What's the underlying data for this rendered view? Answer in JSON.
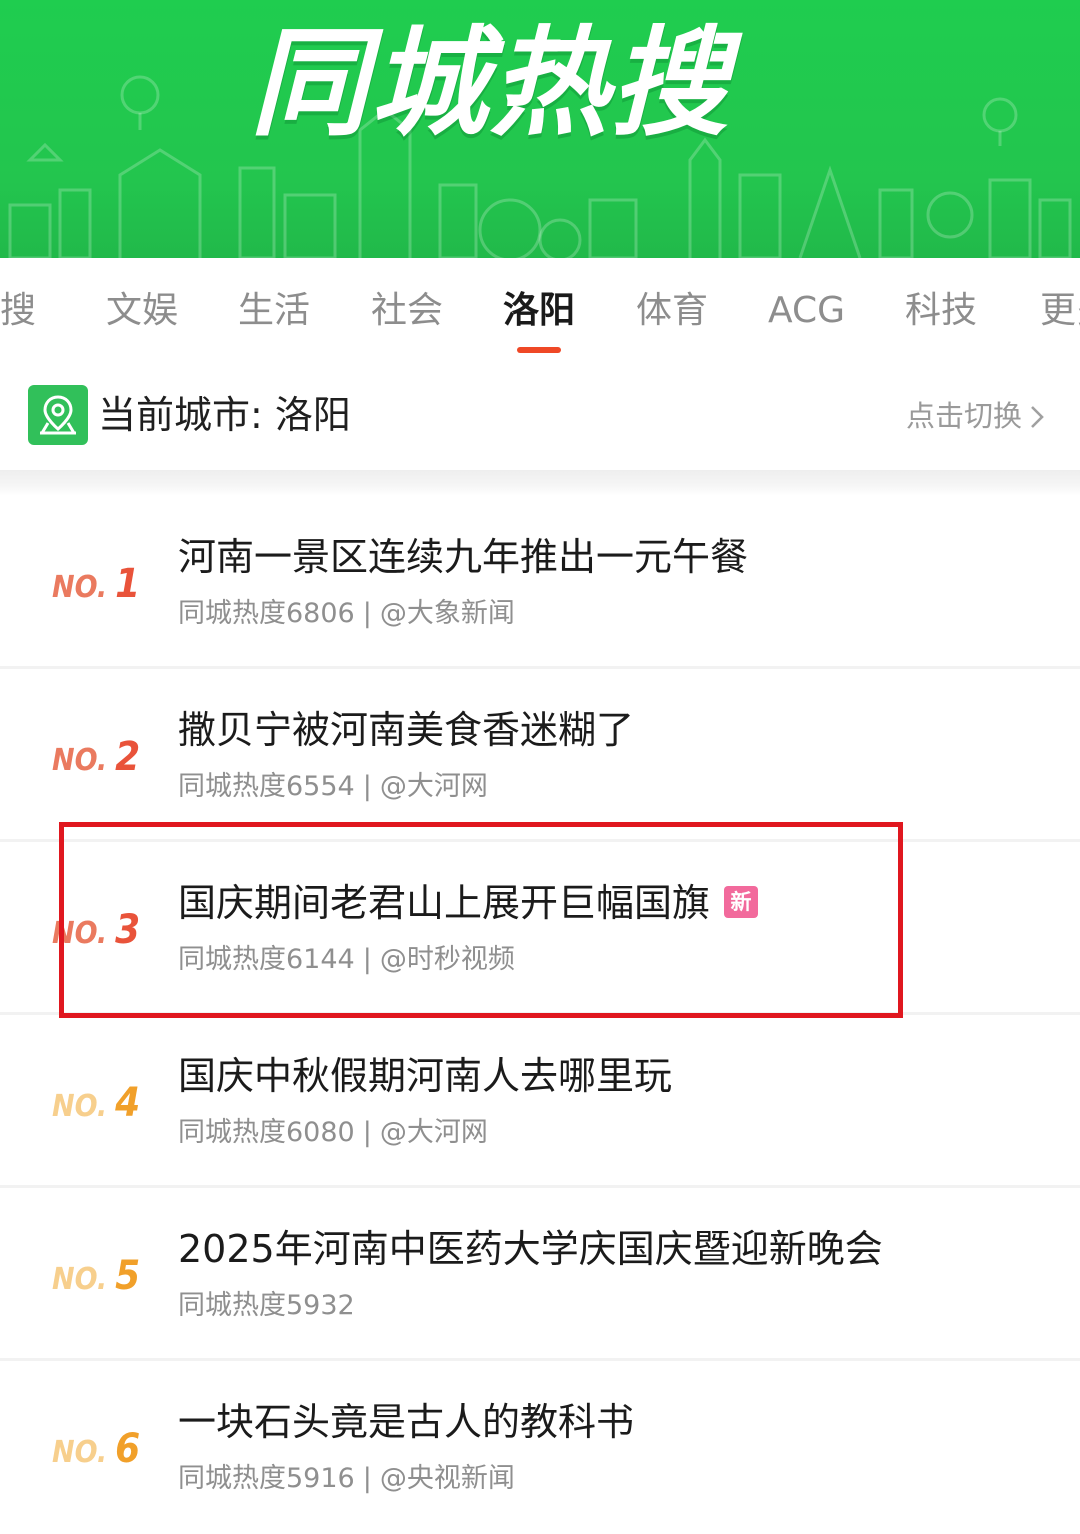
{
  "banner": {
    "title": "同城热搜",
    "background_color": "#23c54e"
  },
  "tabs": {
    "items": [
      {
        "label": "热搜",
        "active": false
      },
      {
        "label": "文娱",
        "active": false
      },
      {
        "label": "生活",
        "active": false
      },
      {
        "label": "社会",
        "active": false
      },
      {
        "label": "洛阳",
        "active": true
      },
      {
        "label": "体育",
        "active": false
      },
      {
        "label": "ACG",
        "active": false
      },
      {
        "label": "科技",
        "active": false
      },
      {
        "label": "更多",
        "active": false
      }
    ],
    "active_underline_color": "#ef4826"
  },
  "city": {
    "label": "当前城市: 洛阳",
    "switch_label": "点击切换",
    "icon": "location-map-icon",
    "icon_color": "#31c05a"
  },
  "list": {
    "items": [
      {
        "rank_prefix": "NO.",
        "rank": "1",
        "title": "河南一景区连续九年推出一元午餐",
        "heat_label": "同城热度",
        "heat_value": "6806",
        "separator": "|",
        "source": "@大象新闻",
        "badge": ""
      },
      {
        "rank_prefix": "NO.",
        "rank": "2",
        "title": "撒贝宁被河南美食香迷糊了",
        "heat_label": "同城热度",
        "heat_value": "6554",
        "separator": "|",
        "source": "@大河网",
        "badge": ""
      },
      {
        "rank_prefix": "NO.",
        "rank": "3",
        "title": "国庆期间老君山上展开巨幅国旗",
        "heat_label": "同城热度",
        "heat_value": "6144",
        "separator": "|",
        "source": "@时秒视频",
        "badge": "新"
      },
      {
        "rank_prefix": "NO.",
        "rank": "4",
        "title": "国庆中秋假期河南人去哪里玩",
        "heat_label": "同城热度",
        "heat_value": "6080",
        "separator": "|",
        "source": "@大河网",
        "badge": ""
      },
      {
        "rank_prefix": "NO.",
        "rank": "5",
        "title": "2025年河南中医药大学庆国庆暨迎新晚会",
        "heat_label": "同城热度",
        "heat_value": "5932",
        "separator": "",
        "source": "",
        "badge": ""
      },
      {
        "rank_prefix": "NO.",
        "rank": "6",
        "title": "一块石头竟是古人的教科书",
        "heat_label": "同城热度",
        "heat_value": "5916",
        "separator": "|",
        "source": "@央视新闻",
        "badge": ""
      }
    ],
    "top_rank_color": "#e9533a",
    "lower_rank_color": "#f1a02a",
    "new_badge_color": "#f26a9c",
    "highlight_color": "#e0171f"
  }
}
